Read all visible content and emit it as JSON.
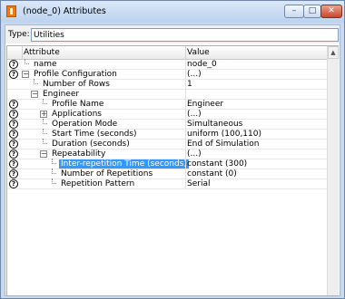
{
  "window": {
    "title": "(node_0) Attributes",
    "controls": {
      "minimize": "–",
      "maximize": "□",
      "close": "✕"
    }
  },
  "type_field": {
    "label": "Type:",
    "value": "Utilities"
  },
  "table": {
    "headers": {
      "attribute": "Attribute",
      "value": "Value"
    },
    "rows": [
      {
        "help": true,
        "toggle": "",
        "indent": 1,
        "name": "name",
        "value": "node_0",
        "selected": false
      },
      {
        "help": true,
        "toggle": "minus",
        "indent": 1,
        "name": "Profile Configuration",
        "value": "(...)",
        "selected": false
      },
      {
        "help": false,
        "toggle": "",
        "indent": 2,
        "name": "Number of Rows",
        "value": "1",
        "selected": false
      },
      {
        "help": false,
        "toggle": "minus",
        "indent": 2,
        "name": "Engineer",
        "value": "",
        "selected": false
      },
      {
        "help": true,
        "toggle": "",
        "indent": 3,
        "name": "Profile Name",
        "value": "Engineer",
        "selected": false
      },
      {
        "help": true,
        "toggle": "plus",
        "indent": 3,
        "name": "Applications",
        "value": "(...)",
        "selected": false
      },
      {
        "help": true,
        "toggle": "",
        "indent": 3,
        "name": "Operation Mode",
        "value": "Simultaneous",
        "selected": false
      },
      {
        "help": true,
        "toggle": "",
        "indent": 3,
        "name": "Start Time (seconds)",
        "value": "uniform (100,110)",
        "selected": false
      },
      {
        "help": true,
        "toggle": "",
        "indent": 3,
        "name": "Duration (seconds)",
        "value": "End of Simulation",
        "selected": false
      },
      {
        "help": true,
        "toggle": "minus",
        "indent": 3,
        "name": "Repeatability",
        "value": "(...)",
        "selected": false
      },
      {
        "help": true,
        "toggle": "",
        "indent": 4,
        "name": "Inter-repetition Time (seconds)",
        "value": "constant (300)",
        "selected": true
      },
      {
        "help": true,
        "toggle": "",
        "indent": 4,
        "name": "Number of Repetitions",
        "value": "constant (0)",
        "selected": false
      },
      {
        "help": true,
        "toggle": "",
        "indent": 4,
        "name": "Repetition Pattern",
        "value": "Serial",
        "selected": false
      }
    ]
  },
  "icons": {
    "help": "question-circle-icon",
    "app": "app-icon"
  }
}
